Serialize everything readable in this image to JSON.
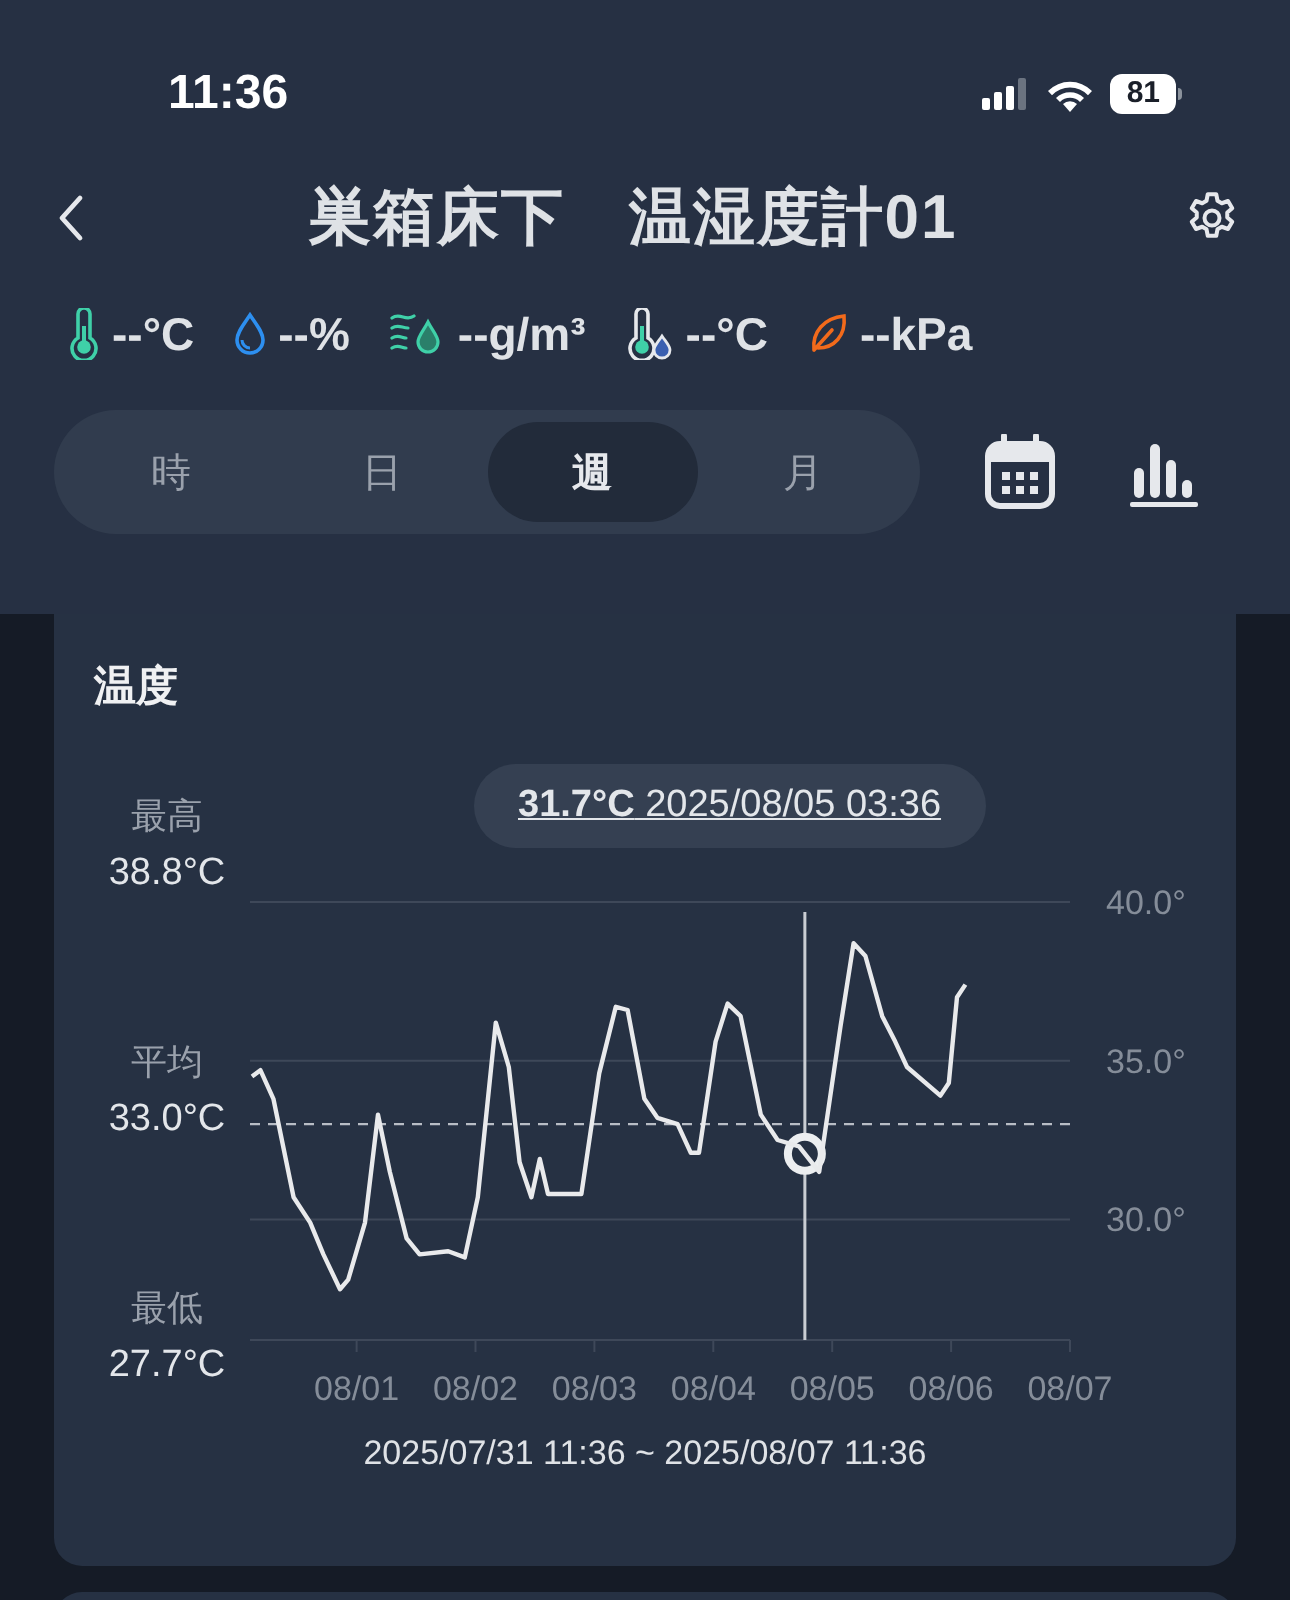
{
  "status_bar": {
    "time": "11:36",
    "battery": "81"
  },
  "header": {
    "title": "巣箱床下　温湿度計01"
  },
  "readings": [
    {
      "kind": "temperature",
      "value": "--°C"
    },
    {
      "kind": "humidity",
      "value": "--%"
    },
    {
      "kind": "absolute_humidity",
      "value": "--g/m³"
    },
    {
      "kind": "dew_point",
      "value": "--°C"
    },
    {
      "kind": "vpd",
      "value": "--kPa"
    }
  ],
  "tabs": [
    {
      "label": "時",
      "selected": false
    },
    {
      "label": "日",
      "selected": false
    },
    {
      "label": "週",
      "selected": true
    },
    {
      "label": "月",
      "selected": false
    }
  ],
  "card": {
    "stats": [
      {
        "label": "最高",
        "value": "38.8°C"
      },
      {
        "label": "平均",
        "value": "33.0°C"
      },
      {
        "label": "最低",
        "value": "27.7°C"
      }
    ],
    "chart_data": {
      "type": "line",
      "title": "温度",
      "x": [
        "2025-07-31T12:00",
        "2025-07-31T13:41",
        "2025-07-31T16:19",
        "2025-07-31T20:24",
        "2025-07-31T23:46",
        "2025-08-01T02:24",
        "2025-08-01T05:46",
        "2025-08-01T07:26",
        "2025-08-01T10:48",
        "2025-08-01T13:26",
        "2025-08-01T15:50",
        "2025-08-01T19:12",
        "2025-08-01T21:50",
        "2025-08-02T03:36",
        "2025-08-02T06:58",
        "2025-08-02T09:36",
        "2025-08-02T13:12",
        "2025-08-02T15:50",
        "2025-08-02T18:00",
        "2025-08-02T20:24",
        "2025-08-02T22:05",
        "2025-08-02T23:46",
        "2025-08-03T06:29",
        "2025-08-03T10:05",
        "2025-08-03T13:26",
        "2025-08-03T15:50",
        "2025-08-03T19:12",
        "2025-08-03T21:50",
        "2025-08-04T01:55",
        "2025-08-04T04:34",
        "2025-08-04T06:14",
        "2025-08-04T09:36",
        "2025-08-04T12:00",
        "2025-08-04T14:38",
        "2025-08-04T18:43",
        "2025-08-04T22:05",
        "2025-08-05T02:24",
        "2025-08-05T06:29",
        "2025-08-05T09:07",
        "2025-08-05T10:48",
        "2025-08-05T13:26",
        "2025-08-05T15:50",
        "2025-08-05T19:12",
        "2025-08-05T21:50",
        "2025-08-06T00:14",
        "2025-08-06T06:58",
        "2025-08-06T08:38",
        "2025-08-06T10:19",
        "2025-08-06T12:00"
      ],
      "series": [
        {
          "color": "#e9eaec",
          "values": [
            34.5,
            34.7,
            33.8,
            30.7,
            29.9,
            28.9,
            27.8,
            28.1,
            29.9,
            33.3,
            31.5,
            29.4,
            28.9,
            29.0,
            28.8,
            30.7,
            36.2,
            34.8,
            31.8,
            30.7,
            31.9,
            30.8,
            30.8,
            34.6,
            36.7,
            36.6,
            33.8,
            33.2,
            33.0,
            32.1,
            32.1,
            35.6,
            36.8,
            36.4,
            33.3,
            32.5,
            32.3,
            31.5,
            34.3,
            36.1,
            38.7,
            38.3,
            36.4,
            35.6,
            34.8,
            33.9,
            34.3,
            37.0,
            37.4
          ]
        }
      ],
      "xlim": [
        "2025-07-31T11:36",
        "2025-08-07T09:07"
      ],
      "ylim": [
        26.2,
        40.0
      ],
      "xticks": [
        {
          "value": "2025-08-01T09:07",
          "label": "08/01"
        },
        {
          "value": "2025-08-02T09:07",
          "label": "08/02"
        },
        {
          "value": "2025-08-03T09:07",
          "label": "08/03"
        },
        {
          "value": "2025-08-04T09:07",
          "label": "08/04"
        },
        {
          "value": "2025-08-05T09:07",
          "label": "08/05"
        },
        {
          "value": "2025-08-06T09:07",
          "label": "08/06"
        },
        {
          "value": "2025-08-07T09:07",
          "label": "08/07"
        }
      ],
      "yticks": [
        {
          "value": 30,
          "label": "30.0°"
        },
        {
          "value": 35,
          "label": "35.0°"
        },
        {
          "value": 40,
          "label": "40.0°"
        }
      ],
      "ref_lines": [
        {
          "axis": "y",
          "value": 33.0
        },
        {
          "axis": "x",
          "value": "2025-08-05T03:36"
        }
      ],
      "annotations": [
        "31.7°C 2025/08/05 03:36"
      ]
    },
    "range": "2025/07/31 11:36 ~ 2025/08/07 11:36"
  }
}
